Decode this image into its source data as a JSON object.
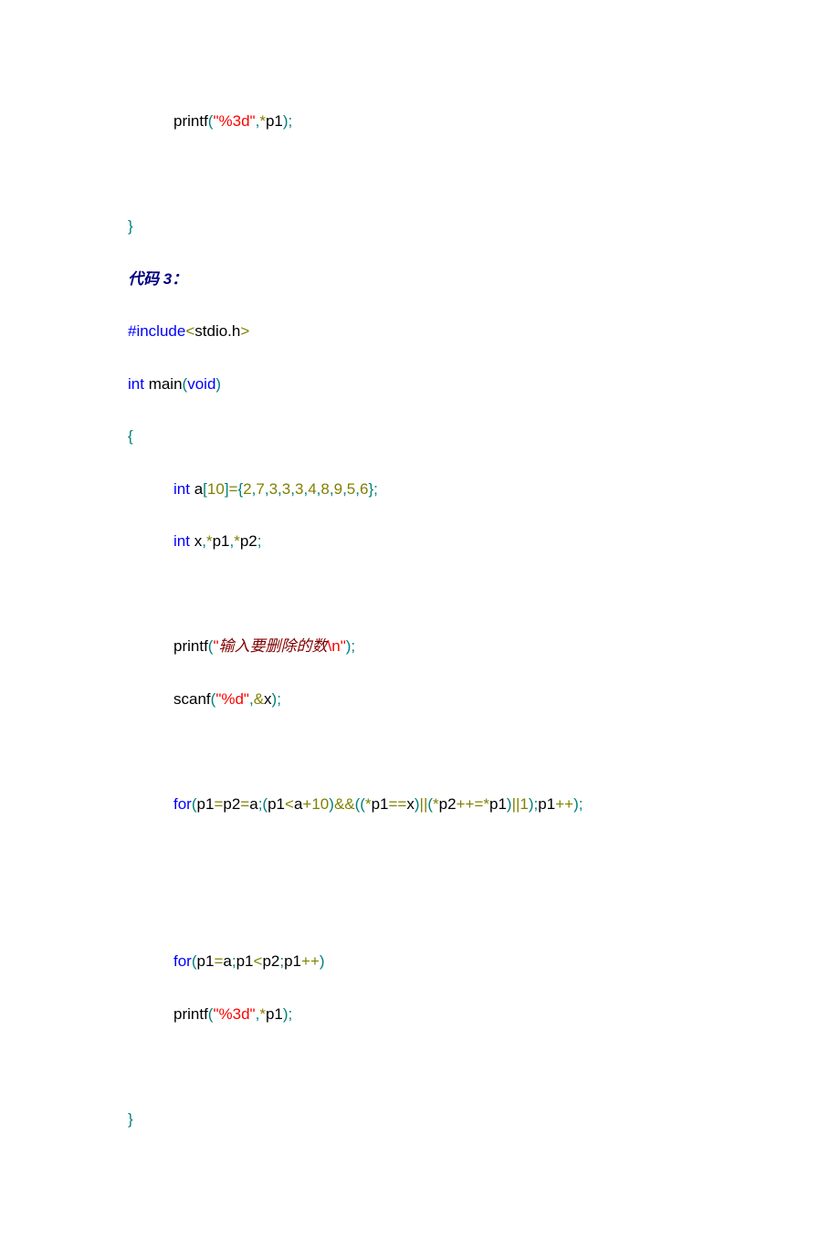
{
  "lines": [
    {
      "indent": true,
      "tokens": [
        {
          "cls": "black",
          "text": "printf"
        },
        {
          "cls": "teal",
          "text": "("
        },
        {
          "cls": "red",
          "text": "\"%3d\""
        },
        {
          "cls": "teal",
          "text": ","
        },
        {
          "cls": "olive",
          "text": "*"
        },
        {
          "cls": "black",
          "text": "p1"
        },
        {
          "cls": "teal",
          "text": ");"
        }
      ]
    },
    {
      "indent": false,
      "tokens": []
    },
    {
      "indent": false,
      "tokens": [
        {
          "cls": "teal",
          "text": "}"
        }
      ]
    },
    {
      "indent": false,
      "tokens": [
        {
          "cls": "bi",
          "text": "代码 3："
        }
      ]
    },
    {
      "indent": false,
      "tokens": [
        {
          "cls": "blue",
          "text": "#include"
        },
        {
          "cls": "olive",
          "text": "<"
        },
        {
          "cls": "black",
          "text": "stdio.h"
        },
        {
          "cls": "olive",
          "text": ">"
        }
      ]
    },
    {
      "indent": false,
      "tokens": [
        {
          "cls": "blue",
          "text": "int"
        },
        {
          "cls": "black",
          "text": " main"
        },
        {
          "cls": "teal",
          "text": "("
        },
        {
          "cls": "blue",
          "text": "void"
        },
        {
          "cls": "teal",
          "text": ")"
        }
      ]
    },
    {
      "indent": false,
      "tokens": [
        {
          "cls": "teal",
          "text": "{"
        }
      ]
    },
    {
      "indent": true,
      "tokens": [
        {
          "cls": "blue",
          "text": "int"
        },
        {
          "cls": "black",
          "text": " a"
        },
        {
          "cls": "teal",
          "text": "["
        },
        {
          "cls": "olive",
          "text": "10"
        },
        {
          "cls": "teal",
          "text": "]"
        },
        {
          "cls": "olive",
          "text": "="
        },
        {
          "cls": "teal",
          "text": "{"
        },
        {
          "cls": "olive",
          "text": "2"
        },
        {
          "cls": "teal",
          "text": ","
        },
        {
          "cls": "olive",
          "text": "7"
        },
        {
          "cls": "teal",
          "text": ","
        },
        {
          "cls": "olive",
          "text": "3"
        },
        {
          "cls": "teal",
          "text": ","
        },
        {
          "cls": "olive",
          "text": "3"
        },
        {
          "cls": "teal",
          "text": ","
        },
        {
          "cls": "olive",
          "text": "3"
        },
        {
          "cls": "teal",
          "text": ","
        },
        {
          "cls": "olive",
          "text": "4"
        },
        {
          "cls": "teal",
          "text": ","
        },
        {
          "cls": "olive",
          "text": "8"
        },
        {
          "cls": "teal",
          "text": ","
        },
        {
          "cls": "olive",
          "text": "9"
        },
        {
          "cls": "teal",
          "text": ","
        },
        {
          "cls": "olive",
          "text": "5"
        },
        {
          "cls": "teal",
          "text": ","
        },
        {
          "cls": "olive",
          "text": "6"
        },
        {
          "cls": "teal",
          "text": "};"
        }
      ]
    },
    {
      "indent": true,
      "tokens": [
        {
          "cls": "blue",
          "text": "int"
        },
        {
          "cls": "black",
          "text": " x"
        },
        {
          "cls": "teal",
          "text": ","
        },
        {
          "cls": "olive",
          "text": "*"
        },
        {
          "cls": "black",
          "text": "p1"
        },
        {
          "cls": "teal",
          "text": ","
        },
        {
          "cls": "olive",
          "text": "*"
        },
        {
          "cls": "black",
          "text": "p2"
        },
        {
          "cls": "teal",
          "text": ";"
        }
      ]
    },
    {
      "indent": true,
      "tokens": []
    },
    {
      "indent": true,
      "tokens": [
        {
          "cls": "black",
          "text": "printf"
        },
        {
          "cls": "teal",
          "text": "("
        },
        {
          "cls": "red",
          "text": "\""
        },
        {
          "cls": "darkred",
          "text": "输入要删除的数"
        },
        {
          "cls": "red",
          "text": "\\n\""
        },
        {
          "cls": "teal",
          "text": ");"
        }
      ]
    },
    {
      "indent": true,
      "tokens": [
        {
          "cls": "black",
          "text": "scanf"
        },
        {
          "cls": "teal",
          "text": "("
        },
        {
          "cls": "red",
          "text": "\"%d\""
        },
        {
          "cls": "teal",
          "text": ","
        },
        {
          "cls": "olive",
          "text": "&"
        },
        {
          "cls": "black",
          "text": "x"
        },
        {
          "cls": "teal",
          "text": ");"
        }
      ]
    },
    {
      "indent": true,
      "tokens": []
    },
    {
      "indent": true,
      "tokens": [
        {
          "cls": "blue",
          "text": "for"
        },
        {
          "cls": "teal",
          "text": "("
        },
        {
          "cls": "black",
          "text": "p1"
        },
        {
          "cls": "olive",
          "text": "="
        },
        {
          "cls": "black",
          "text": "p2"
        },
        {
          "cls": "olive",
          "text": "="
        },
        {
          "cls": "black",
          "text": "a"
        },
        {
          "cls": "teal",
          "text": ";("
        },
        {
          "cls": "black",
          "text": "p1"
        },
        {
          "cls": "olive",
          "text": "<"
        },
        {
          "cls": "black",
          "text": "a"
        },
        {
          "cls": "olive",
          "text": "+10"
        },
        {
          "cls": "teal",
          "text": ")"
        },
        {
          "cls": "olive",
          "text": "&&"
        },
        {
          "cls": "teal",
          "text": "(("
        },
        {
          "cls": "olive",
          "text": "*"
        },
        {
          "cls": "black",
          "text": "p1"
        },
        {
          "cls": "olive",
          "text": "=="
        },
        {
          "cls": "black",
          "text": "x"
        },
        {
          "cls": "teal",
          "text": ")"
        },
        {
          "cls": "olive",
          "text": "||"
        },
        {
          "cls": "teal",
          "text": "("
        },
        {
          "cls": "olive",
          "text": "*"
        },
        {
          "cls": "black",
          "text": "p2"
        },
        {
          "cls": "olive",
          "text": "++=*"
        },
        {
          "cls": "black",
          "text": "p1"
        },
        {
          "cls": "teal",
          "text": ")"
        },
        {
          "cls": "olive",
          "text": "||1"
        },
        {
          "cls": "teal",
          "text": ");"
        },
        {
          "cls": "black",
          "text": "p1"
        },
        {
          "cls": "olive",
          "text": "++"
        },
        {
          "cls": "teal",
          "text": ");"
        }
      ]
    },
    {
      "indent": true,
      "tokens": []
    },
    {
      "indent": true,
      "tokens": []
    },
    {
      "indent": true,
      "tokens": [
        {
          "cls": "blue",
          "text": "for"
        },
        {
          "cls": "teal",
          "text": "("
        },
        {
          "cls": "black",
          "text": "p1"
        },
        {
          "cls": "olive",
          "text": "="
        },
        {
          "cls": "black",
          "text": "a"
        },
        {
          "cls": "teal",
          "text": ";"
        },
        {
          "cls": "black",
          "text": "p1"
        },
        {
          "cls": "olive",
          "text": "<"
        },
        {
          "cls": "black",
          "text": "p2"
        },
        {
          "cls": "teal",
          "text": ";"
        },
        {
          "cls": "black",
          "text": "p1"
        },
        {
          "cls": "olive",
          "text": "++"
        },
        {
          "cls": "teal",
          "text": ")"
        }
      ]
    },
    {
      "indent": true,
      "tokens": [
        {
          "cls": "black",
          "text": "printf"
        },
        {
          "cls": "teal",
          "text": "("
        },
        {
          "cls": "red",
          "text": "\"%3d\""
        },
        {
          "cls": "teal",
          "text": ","
        },
        {
          "cls": "olive",
          "text": "*"
        },
        {
          "cls": "black",
          "text": "p1"
        },
        {
          "cls": "teal",
          "text": ");"
        }
      ]
    },
    {
      "indent": true,
      "tokens": []
    },
    {
      "indent": false,
      "tokens": [
        {
          "cls": "teal",
          "text": "}"
        }
      ]
    }
  ]
}
